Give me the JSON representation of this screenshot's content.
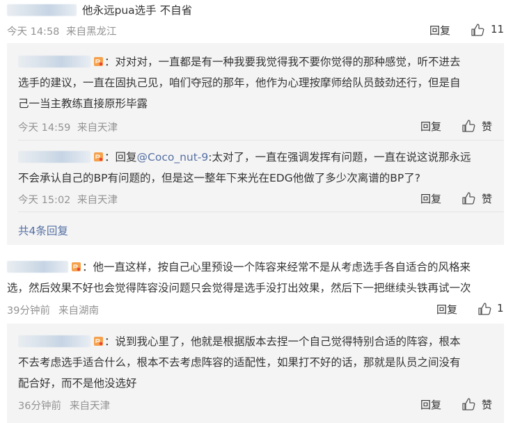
{
  "top": {
    "text": "他永远pua选手 不自省",
    "time": "今天 14:58",
    "location": "来自黑龙江",
    "reply_label": "回复",
    "like_count": "11"
  },
  "reply1": {
    "text_line1": "：对对对，一直都是有一种我要我觉得我不要你觉得的那种感觉，听不进去",
    "text_line2": "选手的建议，一直在固执己见，咱们夺冠的那年，他作为心理按摩师给队员鼓劲还行，但是自",
    "text_line3": "己一当主教练直接原形毕露",
    "time": "今天 14:59",
    "location": "来自天津",
    "reply_label": "回复",
    "like_label": "赞"
  },
  "reply2": {
    "prefix": "：回复",
    "mention": "@Coco_nut-9",
    "text_line1_rest": ":太对了，一直在强调发挥有问题，一直在说这说那永远",
    "text_line2": "不会承认自己的BP有问题的，但是这一整年下来光在EDG他做了多少次离谱的BP了?",
    "time": "今天 15:02",
    "location": "来自天津",
    "reply_label": "回复",
    "like_label": "赞"
  },
  "more_replies": "共4条回复",
  "comment2": {
    "text_line1": "：他一直这样，按自己心里预设一个阵容来经常不是从考虑选手各自适合的风格来",
    "text_line2": "选，然后效果不好也会觉得阵容没问题只会觉得是选手没打出效果，然后下一把继续头铁再试一次",
    "time": "39分钟前",
    "location": "来自湖南",
    "reply_label": "回复",
    "like_count": "1"
  },
  "reply3": {
    "text_line1": "：说到我心里了，他就是根据版本去捏一个自己觉得特别合适的阵容，根本",
    "text_line2": "不去考虑选手适合什么，根本不去考虑阵容的适配性，如果打不好的话，那就是队员之间没有",
    "text_line3": "配合好，而不是他没选好",
    "time": "36分钟前",
    "location": "来自天津",
    "reply_label": "回复",
    "like_label": "赞"
  },
  "colors": {
    "link": "#5570a4",
    "meta": "#939393",
    "subbox": "#f4f4f4"
  }
}
